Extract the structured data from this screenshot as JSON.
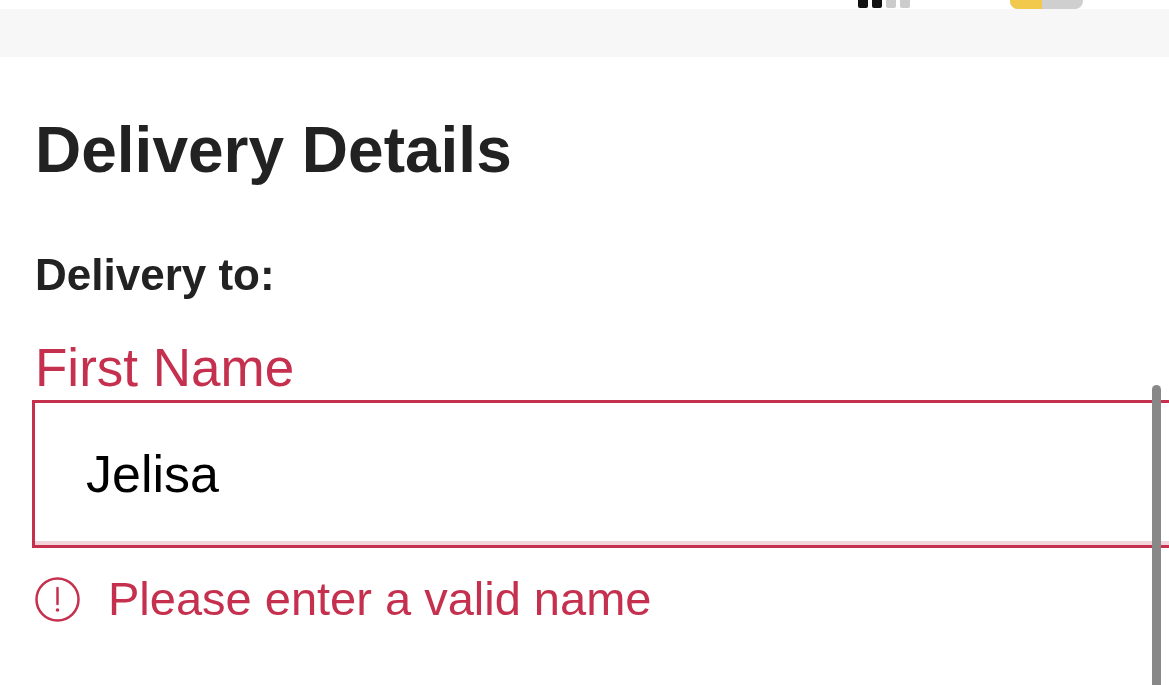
{
  "page": {
    "title": "Delivery Details",
    "section_label": "Delivery to:"
  },
  "first_name_field": {
    "label": "First Name",
    "value": "Jelisa",
    "invalid": true,
    "error": "Please enter a valid name"
  }
}
